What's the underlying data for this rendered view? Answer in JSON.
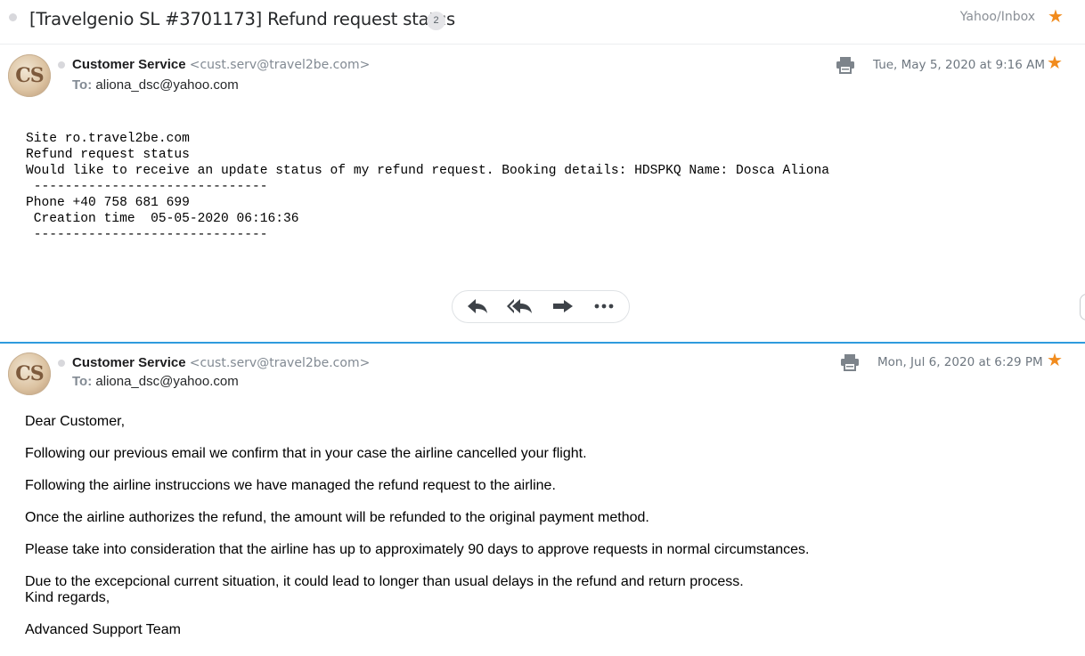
{
  "thread": {
    "subject": "[Travelgenio SL #3701173] Refund request status",
    "message_count": "2",
    "folder": "Yahoo/Inbox"
  },
  "messages": [
    {
      "avatar_initials": "CS",
      "sender_name": "Customer Service",
      "sender_email": "<cust.serv@travel2be.com>",
      "to_label": "To:",
      "to_address": "aliona_dsc@yahoo.com",
      "date": "Tue, May 5, 2020 at 9:16 AM",
      "body_lines": [
        "Site ro.travel2be.com",
        "Refund request status",
        "Would like to receive an update status of my refund request. Booking details: HDSPKQ Name: Dosca Aliona",
        " ------------------------------",
        "Phone +40 758 681 699",
        " Creation time  05-05-2020 06:16:36",
        " ------------------------------"
      ]
    },
    {
      "avatar_initials": "CS",
      "sender_name": "Customer Service",
      "sender_email": "<cust.serv@travel2be.com>",
      "to_label": "To:",
      "to_address": "aliona_dsc@yahoo.com",
      "date": "Mon, Jul 6, 2020 at 6:29 PM",
      "body_lines": [
        "Dear Customer,",
        "Following our previous email we confirm that in your case the airline cancelled your flight.",
        "Following the airline instruccions we have managed the refund request to the airline.",
        "Once the airline authorizes the refund, the amount will be refunded to the original payment method.",
        "Please take into consideration that the airline has up to approximately 90 days to approve requests in normal circumstances.",
        "Due to the excepcional current situation,  it could lead to longer than usual delays in the refund and return process.",
        "Kind regards,",
        "Advanced Support Team"
      ]
    }
  ],
  "icons": {
    "star": "star-icon",
    "print": "print-icon",
    "reply": "reply-icon",
    "reply_all": "reply-all-icon",
    "forward": "forward-icon",
    "more": "more-icon"
  },
  "colors": {
    "star": "#f18b1d",
    "divider_accent": "#2f9bdd",
    "meta_text": "#6e7780"
  }
}
